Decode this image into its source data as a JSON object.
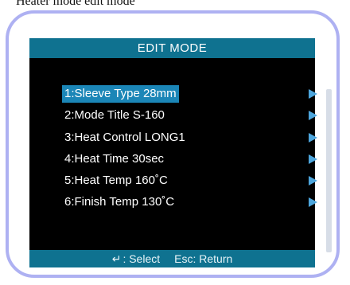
{
  "caption": "Heater mode edit mode",
  "screen": {
    "title": "EDIT MODE",
    "items": [
      {
        "label": "1:Sleeve Type 28mm",
        "selected": true
      },
      {
        "label": "2:Mode Title S-160",
        "selected": false
      },
      {
        "label": "3:Heat Control LONG1",
        "selected": false
      },
      {
        "label": "4:Heat Time 30sec",
        "selected": false
      },
      {
        "label": "5:Heat Temp 160˚C",
        "selected": false
      },
      {
        "label": "6:Finish Temp 130˚C",
        "selected": false
      }
    ],
    "footer": {
      "select_icon": "↵",
      "select_label": ": Select",
      "return_label": "Esc: Return"
    }
  },
  "colors": {
    "title_bar": "#0f7290",
    "selected_row": "#1b86b7",
    "arrow": "#4da6dd",
    "frame_border": "#aeb1f2"
  }
}
